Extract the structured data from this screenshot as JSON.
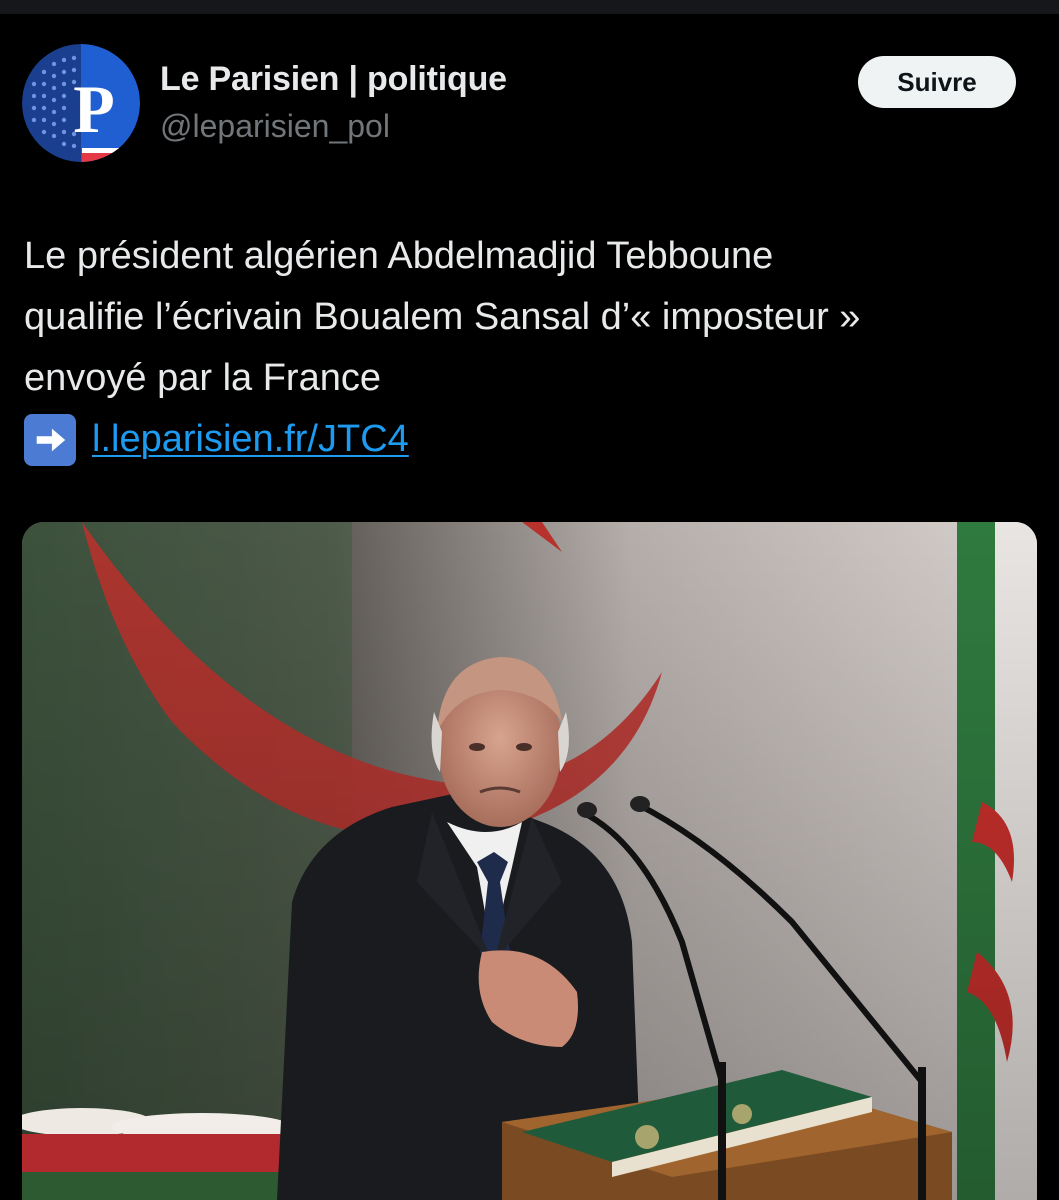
{
  "account": {
    "display_name": "Le Parisien | politique",
    "handle": "@leparisien_pol",
    "avatar_letter": "P",
    "avatar_icon": "le-parisien-logo"
  },
  "follow_button": {
    "label": "Suivre"
  },
  "tweet": {
    "lines": [
      "Le président algérien Abdelmadjid Tebboune",
      "qualifie l’écrivain Boualem Sansal d’« imposteur »",
      "envoyé par la France"
    ],
    "link_icon": "right-arrow-emoji",
    "link_text": "l.leparisien.fr/JTC4"
  },
  "colors": {
    "background": "#000000",
    "text": "#e7e9ea",
    "secondary": "#71767b",
    "link": "#1d9bf0",
    "brand_blue": "#1f5fd1"
  }
}
